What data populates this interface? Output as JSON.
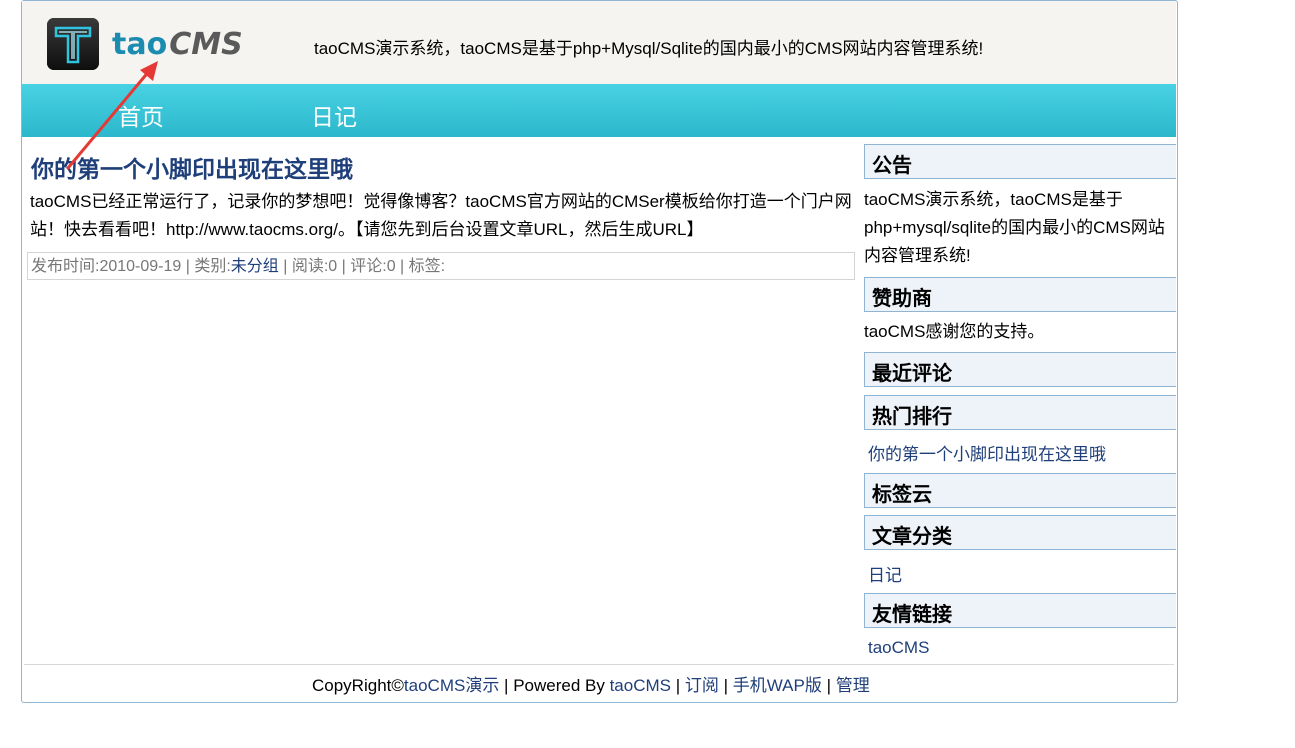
{
  "header": {
    "logo_tao": "tao",
    "logo_cms": "CMS",
    "tagline": "taoCMS演示系统，taoCMS是基于php+Mysql/Sqlite的国内最小的CMS网站内容管理系统!"
  },
  "nav": {
    "home": "首页",
    "diary": "日记"
  },
  "post": {
    "title": "你的第一个小脚印出现在这里哦",
    "body": "taoCMS已经正常运行了，记录你的梦想吧！觉得像博客？taoCMS官方网站的CMSer模板给你打造一个门户网站！快去看看吧！http://www.taocms.org/。【请您先到后台设置文章URL，然后生成URL】",
    "meta_prefix": "发布时间:2010-09-19 | 类别:",
    "category": "未分组",
    "meta_suffix": " | 阅读:0 | 评论:0 | 标签:"
  },
  "sidebar": {
    "notice_title": "公告",
    "notice_text": "taoCMS演示系统，taoCMS是基于php+mysql/sqlite的国内最小的CMS网站内容管理系统!",
    "sponsor_title": "赞助商",
    "sponsor_text": "taoCMS感谢您的支持。",
    "recent_comments_title": "最近评论",
    "hot_title": "热门排行",
    "hot_items": [
      "你的第一个小脚印出现在这里哦"
    ],
    "tags_title": "标签云",
    "categories_title": "文章分类",
    "categories": [
      "日记"
    ],
    "links_title": "友情链接",
    "links": [
      "taoCMS"
    ]
  },
  "footer": {
    "prefix": "CopyRight©",
    "demo_link": "taoCMS演示",
    "powered": " | Powered By ",
    "powered_link": "taoCMS",
    "sep": " | ",
    "subscribe": "订阅",
    "wap": "手机WAP版",
    "admin": "管理"
  },
  "colors": {
    "nav_gradient_top": "#48d2e3",
    "nav_gradient_bottom": "#2cb7cc",
    "title_blue": "#1f3f7a",
    "annotation_arrow": "#e53935"
  }
}
